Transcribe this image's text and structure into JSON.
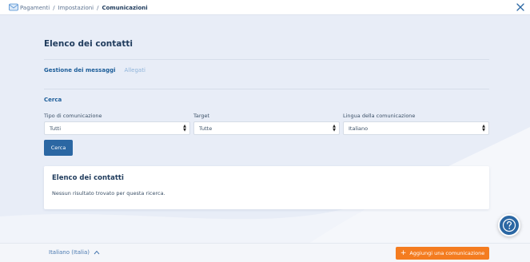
{
  "breadcrumb": {
    "items": [
      "Pagamenti",
      "Impostazioni"
    ],
    "separator": "/",
    "current": "Comunicazioni"
  },
  "icons": {
    "logo": "envelope-app-icon",
    "close": "close-icon",
    "help": "question-mark-icon",
    "language_toggle": "chevron-up-icon",
    "add": "plus-icon",
    "select_arrows": "up-down-arrows-icon"
  },
  "page": {
    "title": "Elenco dei contatti"
  },
  "tabs": [
    {
      "label": "Gestione dei messaggi",
      "active": true
    },
    {
      "label": "Allegati",
      "active": false
    }
  ],
  "search": {
    "section_label": "Cerca",
    "filters": [
      {
        "label": "Tipo di comunicazione",
        "value": "Tutti"
      },
      {
        "label": "Target",
        "value": "Tutte"
      },
      {
        "label": "Lingua della comunicazione",
        "value": "Italiano"
      }
    ],
    "button_label": "Cerca"
  },
  "results": {
    "title": "Elenco dei contatti",
    "empty_message": "Nessun risultato trovato per questa ricerca."
  },
  "footer": {
    "language": "Italiano (Italia)",
    "add_button_label": "Aggiungi una comunicazione"
  },
  "colors": {
    "primary": "#2b67a3",
    "accent_orange": "#f47c20",
    "background": "#e8edf7",
    "title_text": "#1f3b5c"
  }
}
